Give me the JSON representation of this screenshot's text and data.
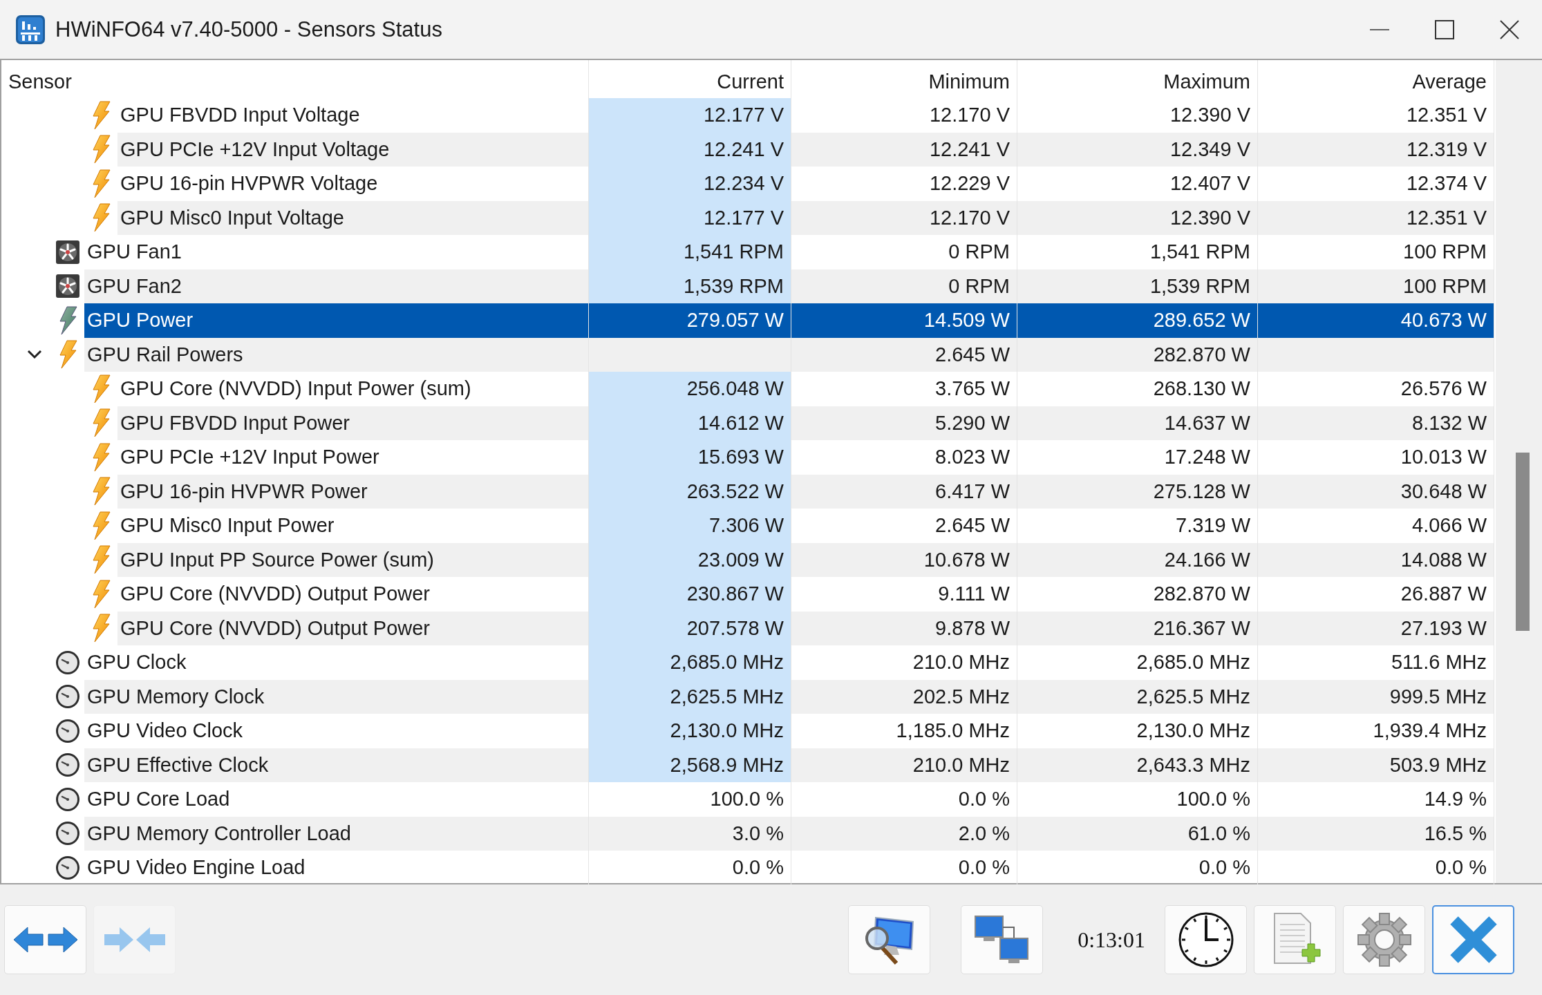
{
  "window": {
    "title": "HWiNFO64 v7.40-5000 - Sensors Status"
  },
  "table": {
    "columns": [
      "Sensor",
      "Current",
      "Minimum",
      "Maximum",
      "Average"
    ],
    "rows_continued": [
      {
        "kind": "voltage",
        "name": "GPU FBVDD Input Voltage",
        "current": "12.177 V",
        "minimum": "12.170 V",
        "maximum": "12.390 V",
        "average": "12.351 V",
        "live": true,
        "selected": false
      },
      {
        "kind": "voltage",
        "name": "GPU PCIe +12V Input Voltage",
        "current": "12.241 V",
        "minimum": "12.241 V",
        "maximum": "12.349 V",
        "average": "12.319 V",
        "live": true,
        "selected": false
      },
      {
        "kind": "voltage",
        "name": "GPU 16-pin HVPWR Voltage",
        "current": "12.234 V",
        "minimum": "12.229 V",
        "maximum": "12.407 V",
        "average": "12.374 V",
        "live": true,
        "selected": false
      },
      {
        "kind": "voltage",
        "name": "GPU Misc0 Input Voltage",
        "current": "12.177 V",
        "minimum": "12.170 V",
        "maximum": "12.390 V",
        "average": "12.351 V",
        "live": true,
        "selected": false
      }
    ],
    "rows": [
      {
        "kind": "fan",
        "name": "GPU Fan1",
        "current": "1,541 RPM",
        "minimum": "0 RPM",
        "maximum": "1,541 RPM",
        "average": "100 RPM",
        "live": true,
        "selected": false
      },
      {
        "kind": "fan",
        "name": "GPU Fan2",
        "current": "1,539 RPM",
        "minimum": "0 RPM",
        "maximum": "1,539 RPM",
        "average": "100 RPM",
        "live": true,
        "selected": false
      },
      {
        "kind": "total",
        "name": "GPU Power",
        "current": "279.057 W",
        "minimum": "14.509 W",
        "maximum": "289.652 W",
        "average": "40.673 W",
        "live": true,
        "selected": true
      },
      {
        "kind": "power",
        "name": "GPU Rail Powers",
        "minimum": "2.645 W",
        "maximum": "282.870 W",
        "live": false,
        "selected": false,
        "expanded": true,
        "children": [
          {
            "kind": "power",
            "name": "GPU Core (NVVDD) Input Power (sum)",
            "current": "256.048 W",
            "minimum": "3.765 W",
            "maximum": "268.130 W",
            "average": "26.576 W",
            "live": true,
            "selected": false
          },
          {
            "kind": "power",
            "name": "GPU FBVDD Input Power",
            "current": "14.612 W",
            "minimum": "5.290 W",
            "maximum": "14.637 W",
            "average": "8.132 W",
            "live": true,
            "selected": false
          },
          {
            "kind": "power",
            "name": "GPU PCIe +12V Input Power",
            "current": "15.693 W",
            "minimum": "8.023 W",
            "maximum": "17.248 W",
            "average": "10.013 W",
            "live": true,
            "selected": false
          },
          {
            "kind": "power",
            "name": "GPU 16-pin HVPWR Power",
            "current": "263.522 W",
            "minimum": "6.417 W",
            "maximum": "275.128 W",
            "average": "30.648 W",
            "live": true,
            "selected": false
          },
          {
            "kind": "power",
            "name": "GPU Misc0 Input Power",
            "current": "7.306 W",
            "minimum": "2.645 W",
            "maximum": "7.319 W",
            "average": "4.066 W",
            "live": true,
            "selected": false
          },
          {
            "kind": "power",
            "name": "GPU Input PP Source Power (sum)",
            "current": "23.009 W",
            "minimum": "10.678 W",
            "maximum": "24.166 W",
            "average": "14.088 W",
            "live": true,
            "selected": false
          },
          {
            "kind": "power",
            "name": "GPU Core (NVVDD) Output Power",
            "current": "230.867 W",
            "minimum": "9.111 W",
            "maximum": "282.870 W",
            "average": "26.887 W",
            "live": true,
            "selected": false
          },
          {
            "kind": "power",
            "name": "GPU Core (NVVDD) Output Power",
            "current": "207.578 W",
            "minimum": "9.878 W",
            "maximum": "216.367 W",
            "average": "27.193 W",
            "live": true,
            "selected": false
          }
        ]
      },
      {
        "kind": "clock",
        "name": "GPU Clock",
        "current": "2,685.0 MHz",
        "minimum": "210.0 MHz",
        "maximum": "2,685.0 MHz",
        "average": "511.6 MHz",
        "live": true,
        "selected": false
      },
      {
        "kind": "clock",
        "name": "GPU Memory Clock",
        "current": "2,625.5 MHz",
        "minimum": "202.5 MHz",
        "maximum": "2,625.5 MHz",
        "average": "999.5 MHz",
        "live": true,
        "selected": false
      },
      {
        "kind": "clock",
        "name": "GPU Video Clock",
        "current": "2,130.0 MHz",
        "minimum": "1,185.0 MHz",
        "maximum": "2,130.0 MHz",
        "average": "1,939.4 MHz",
        "live": true,
        "selected": false
      },
      {
        "kind": "clock",
        "name": "GPU Effective Clock",
        "current": "2,568.9 MHz",
        "minimum": "210.0 MHz",
        "maximum": "2,643.3 MHz",
        "average": "503.9 MHz",
        "live": true,
        "selected": false
      },
      {
        "kind": "load",
        "name": "GPU Core Load",
        "current": "100.0 %",
        "minimum": "0.0 %",
        "maximum": "100.0 %",
        "average": "14.9 %",
        "live": false,
        "selected": false
      },
      {
        "kind": "load",
        "name": "GPU Memory Controller Load",
        "current": "3.0 %",
        "minimum": "2.0 %",
        "maximum": "61.0 %",
        "average": "16.5 %",
        "live": false,
        "selected": false
      },
      {
        "kind": "load",
        "name": "GPU Video Engine Load",
        "current": "0.0 %",
        "minimum": "0.0 %",
        "maximum": "0.0 %",
        "average": "0.0 %",
        "live": false,
        "selected": false
      }
    ]
  },
  "toolbar": {
    "left_buttons": [
      {
        "kind": "expand",
        "disabled": false
      },
      {
        "kind": "collapse",
        "disabled": true
      }
    ],
    "middle_buttons": [
      {
        "kind": "sensors",
        "focused": false
      },
      {
        "kind": "network",
        "focused": false
      }
    ],
    "timer": "0:13:01",
    "right_buttons": [
      {
        "kind": "clock",
        "focused": false
      },
      {
        "kind": "log",
        "focused": false
      },
      {
        "kind": "settings",
        "focused": false
      },
      {
        "kind": "close",
        "focused": true
      }
    ]
  }
}
